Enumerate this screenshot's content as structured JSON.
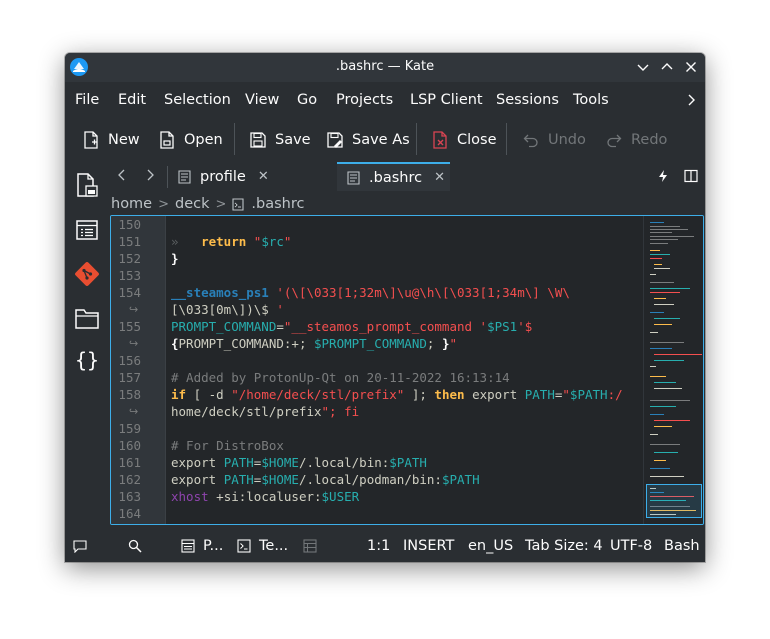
{
  "window": {
    "title": ".bashrc — Kate"
  },
  "menu": [
    "File",
    "Edit",
    "Selection",
    "View",
    "Go",
    "Projects",
    "LSP Client",
    "Sessions",
    "Tools"
  ],
  "toolbar": {
    "new": "New",
    "open": "Open",
    "save": "Save",
    "save_as": "Save As",
    "close": "Close",
    "undo": "Undo",
    "redo": "Redo"
  },
  "tabs": [
    {
      "label": "profile",
      "active": false
    },
    {
      "label": ".bashrc",
      "active": true
    }
  ],
  "breadcrumb": [
    "home",
    "deck",
    ".bashrc"
  ],
  "editor": {
    "lines": [
      {
        "n": "150",
        "wrap": false,
        "text": ""
      },
      {
        "n": "151",
        "wrap": false,
        "text": "»   return \"$rc\""
      },
      {
        "n": "152",
        "wrap": false,
        "text": "}"
      },
      {
        "n": "153",
        "wrap": false,
        "text": ""
      },
      {
        "n": "154",
        "wrap": false,
        "text": "__steamos_ps1 '(\\[\\033[1;32m\\]\\u@\\h\\[\\033[1;34m\\] \\W\\"
      },
      {
        "n": "",
        "wrap": true,
        "text": "[\\033[0m\\])\\$ '"
      },
      {
        "n": "155",
        "wrap": false,
        "text": "PROMPT_COMMAND=\"__steamos_prompt_command '$PS1'$"
      },
      {
        "n": "",
        "wrap": true,
        "text": "{PROMPT_COMMAND:+; $PROMPT_COMMAND; }\""
      },
      {
        "n": "156",
        "wrap": false,
        "text": ""
      },
      {
        "n": "157",
        "wrap": false,
        "text": "# Added by ProtonUp-Qt on 20-11-2022 16:13:14"
      },
      {
        "n": "158",
        "wrap": false,
        "text": "if [ -d \"/home/deck/stl/prefix\" ]; then export PATH=\"$PATH:/"
      },
      {
        "n": "",
        "wrap": true,
        "text": "home/deck/stl/prefix\"; fi"
      },
      {
        "n": "159",
        "wrap": false,
        "text": ""
      },
      {
        "n": "160",
        "wrap": false,
        "text": "# For DistroBox"
      },
      {
        "n": "161",
        "wrap": false,
        "text": "export PATH=$HOME/.local/bin:$PATH"
      },
      {
        "n": "162",
        "wrap": false,
        "text": "export PATH=$HOME/.local/podman/bin:$PATH"
      },
      {
        "n": "163",
        "wrap": false,
        "text": "xhost +si:localuser:$USER"
      },
      {
        "n": "164",
        "wrap": false,
        "text": ""
      }
    ]
  },
  "statusbar": {
    "projects": "P...",
    "terminal": "Te...",
    "cursor": "1:1",
    "mode": "INSERT",
    "dictionary": "en_US",
    "tab_size": "Tab Size: 4",
    "encoding": "UTF-8",
    "syntax": "Bash"
  },
  "colors": {
    "accent": "#3daee9",
    "background": "#2a2e32",
    "editor_background": "#232629",
    "git_icon": "#e84e31",
    "close_icon": "#da4453"
  },
  "icons": [
    "kate-app-icon",
    "minimize-icon",
    "maximize-icon",
    "close-window-icon",
    "chevron-right-icon",
    "new-document-icon",
    "open-document-icon",
    "save-icon",
    "save-as-icon",
    "close-document-icon",
    "undo-icon",
    "redo-icon",
    "documents-icon",
    "projects-list-icon",
    "git-icon",
    "folder-icon",
    "symbols-icon",
    "split-view-icon",
    "quick-open-icon",
    "comment-icon",
    "search-icon",
    "terminal-icon",
    "output-icon"
  ]
}
